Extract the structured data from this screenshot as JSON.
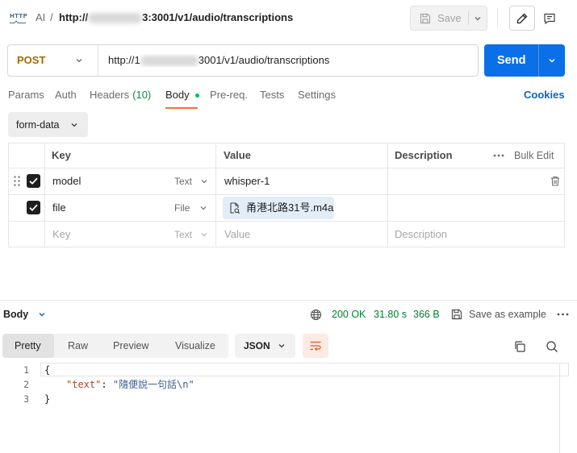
{
  "header": {
    "request_icon_text": "HTTP",
    "breadcrumb_collection": "AI",
    "breadcrumb_separator": "/",
    "url_prefix": "http://",
    "url_suffix": "3:3001/v1/audio/transcriptions",
    "save_label": "Save"
  },
  "request": {
    "method": "POST",
    "url_prefix": "http://1",
    "url_suffix": "3001/v1/audio/transcriptions",
    "send_label": "Send"
  },
  "tabs": [
    {
      "label": "Params"
    },
    {
      "label": "Auth"
    },
    {
      "label": "Headers",
      "count": "(10)"
    },
    {
      "label": "Body",
      "active": true
    },
    {
      "label": "Pre-req."
    },
    {
      "label": "Tests"
    },
    {
      "label": "Settings"
    }
  ],
  "cookies_label": "Cookies",
  "body": {
    "mode": "form-data",
    "table": {
      "headers": {
        "key": "Key",
        "value": "Value",
        "description": "Description",
        "bulk_edit": "Bulk Edit"
      },
      "rows": [
        {
          "checked": true,
          "key": "model",
          "type": "Text",
          "value": "whisper-1"
        },
        {
          "checked": true,
          "key": "file",
          "type": "File",
          "value": "甬港北路31号.m4a"
        }
      ],
      "placeholder": {
        "key": "Key",
        "type": "Text",
        "value": "Value",
        "description": "Description"
      }
    }
  },
  "response": {
    "section_label": "Body",
    "status": "200 OK",
    "time": "31.80 s",
    "size": "366 B",
    "save_example_label": "Save as example",
    "view_tabs": [
      {
        "label": "Pretty",
        "selected": true
      },
      {
        "label": "Raw"
      },
      {
        "label": "Preview"
      },
      {
        "label": "Visualize"
      }
    ],
    "format": "JSON",
    "code": {
      "line_numbers": [
        "1",
        "2",
        "3"
      ],
      "line1": "{",
      "line2_key": "\"text\"",
      "line2_sep": ": ",
      "line2_value": "\"隨便說一句話\\n\"",
      "line3": "}"
    }
  },
  "icons": {
    "request": "http-request-icon",
    "save": "save-icon",
    "edit": "pencil-icon",
    "comments": "comment-icon",
    "dropdown": "chevron-down-icon",
    "drag": "drag-handle-icon",
    "delete": "trash-icon",
    "file": "file-icon",
    "network": "globe-icon",
    "wrap": "wrap-lines-icon",
    "copy": "copy-icon",
    "search": "search-icon",
    "more": "more-options-icon"
  },
  "colors": {
    "accent": "#FF6C37",
    "primary": "#0B6FE8",
    "link": "#0265D2",
    "success": "#007F31",
    "method_post": "#A66B00",
    "body_dot": "#0CBB52"
  }
}
